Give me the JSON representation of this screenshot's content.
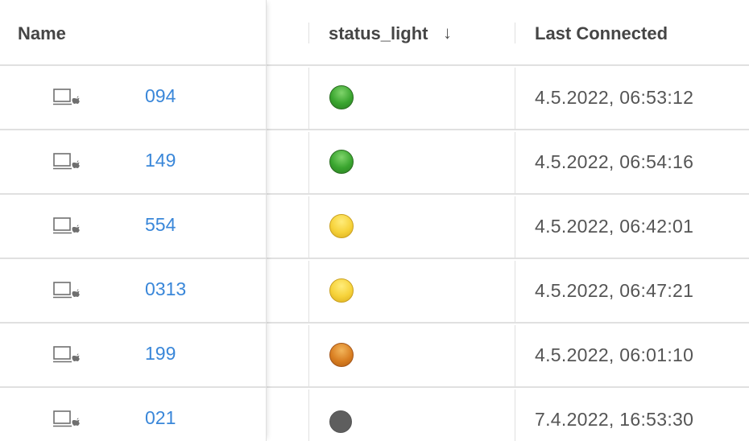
{
  "columns": {
    "name": "Name",
    "status_light": "status_light",
    "last_connected": "Last Connected",
    "sort_indicator": "↓"
  },
  "rows": [
    {
      "device_id": "094",
      "status": "green",
      "last_connected": "4.5.2022, 06:53:12"
    },
    {
      "device_id": "149",
      "status": "green",
      "last_connected": "4.5.2022, 06:54:16"
    },
    {
      "device_id": "554",
      "status": "yellow",
      "last_connected": "4.5.2022, 06:42:01"
    },
    {
      "device_id": "0313",
      "status": "yellow",
      "last_connected": "4.5.2022, 06:47:21"
    },
    {
      "device_id": "199",
      "status": "orange",
      "last_connected": "4.5.2022, 06:01:10"
    },
    {
      "device_id": "021",
      "status": "grey",
      "last_connected": "7.4.2022, 16:53:30"
    }
  ],
  "icons": {
    "device": "laptop-apple-icon"
  },
  "colors": {
    "link": "#3a87d9",
    "green": "#3aa52f",
    "yellow": "#f6d23a",
    "orange": "#d97f22",
    "grey": "#5e5e5e"
  }
}
